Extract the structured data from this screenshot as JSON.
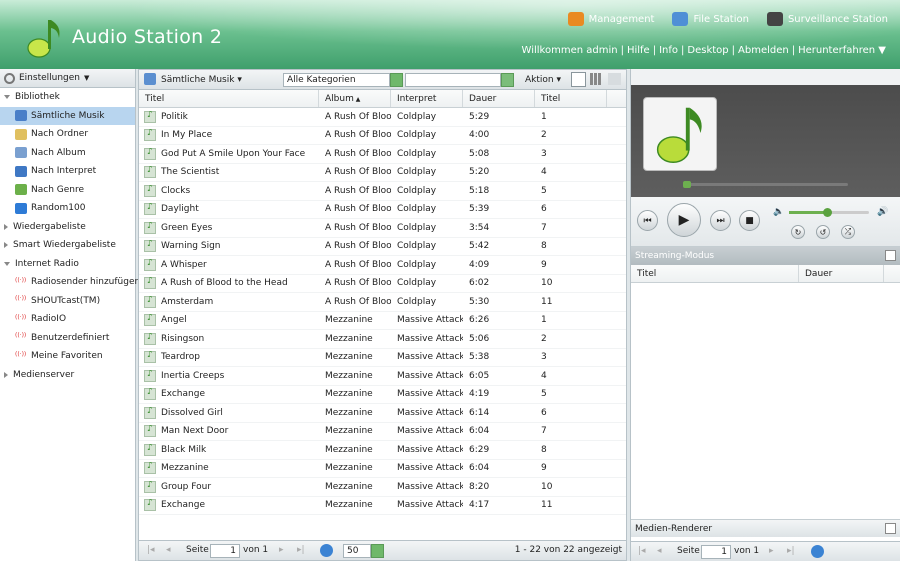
{
  "app": {
    "title": "Audio Station 2"
  },
  "top_links": [
    {
      "label": "Management",
      "icon": "management-icon",
      "color": "#e98a22"
    },
    {
      "label": "File Station",
      "icon": "file-station-icon",
      "color": "#4f8fd6"
    },
    {
      "label": "Surveillance Station",
      "icon": "camera-icon",
      "color": "#444444"
    }
  ],
  "user_bar": {
    "welcome": "Willkommen admin",
    "help": "Hilfe",
    "info": "Info",
    "desktop": "Desktop",
    "logout": "Abmelden",
    "shutdown": "Herunterfahren"
  },
  "left": {
    "settings_label": "Einstellungen",
    "library": {
      "label": "Bibliothek",
      "items": [
        {
          "label": "Sämtliche Musik",
          "icon": "music-note-icon",
          "color": "#4a7fc8"
        },
        {
          "label": "Nach Ordner",
          "icon": "folder-icon",
          "color": "#e0c060"
        },
        {
          "label": "Nach Album",
          "icon": "cd-icon",
          "color": "#7aa0d0"
        },
        {
          "label": "Nach Interpret",
          "icon": "person-icon",
          "color": "#3f78c4"
        },
        {
          "label": "Nach Genre",
          "icon": "genre-icon",
          "color": "#6cb04a"
        },
        {
          "label": "Random100",
          "icon": "random-icon",
          "color": "#2e7bd6"
        }
      ]
    },
    "playlist": {
      "label": "Wiedergabeliste"
    },
    "smart_playlist": {
      "label": "Smart Wiedergabeliste"
    },
    "radio": {
      "label": "Internet Radio",
      "items": [
        {
          "label": "Radiosender hinzufügen",
          "icon": "radio-add-icon"
        },
        {
          "label": "SHOUTcast(TM)",
          "icon": "radio-icon"
        },
        {
          "label": "RadioIO",
          "icon": "radio-icon"
        },
        {
          "label": "Benutzerdefiniert",
          "icon": "radio-icon"
        },
        {
          "label": "Meine Favoriten",
          "icon": "radio-icon"
        }
      ]
    },
    "media_server": {
      "label": "Medienserver"
    }
  },
  "center": {
    "source_label": "Sämtliche Musik",
    "category": "Alle Kategorien",
    "search": "",
    "action_label": "Aktion",
    "columns": [
      "Titel",
      "Album",
      "Interpret",
      "Dauer",
      "Titel"
    ],
    "rows": [
      [
        "Politik",
        "A Rush Of Blood",
        "Coldplay",
        "5:29",
        "1"
      ],
      [
        "In My Place",
        "A Rush Of Blood",
        "Coldplay",
        "4:00",
        "2"
      ],
      [
        "God Put A Smile Upon Your Face",
        "A Rush Of Blood",
        "Coldplay",
        "5:08",
        "3"
      ],
      [
        "The Scientist",
        "A Rush Of Blood",
        "Coldplay",
        "5:20",
        "4"
      ],
      [
        "Clocks",
        "A Rush Of Blood",
        "Coldplay",
        "5:18",
        "5"
      ],
      [
        "Daylight",
        "A Rush Of Blood",
        "Coldplay",
        "5:39",
        "6"
      ],
      [
        "Green Eyes",
        "A Rush Of Blood",
        "Coldplay",
        "3:54",
        "7"
      ],
      [
        "Warning Sign",
        "A Rush Of Blood",
        "Coldplay",
        "5:42",
        "8"
      ],
      [
        "A Whisper",
        "A Rush Of Blood",
        "Coldplay",
        "4:09",
        "9"
      ],
      [
        "A Rush of Blood to the Head",
        "A Rush Of Blood",
        "Coldplay",
        "6:02",
        "10"
      ],
      [
        "Amsterdam",
        "A Rush Of Blood",
        "Coldplay",
        "5:30",
        "11"
      ],
      [
        "Angel",
        "Mezzanine",
        "Massive Attack",
        "6:26",
        "1"
      ],
      [
        "Risingson",
        "Mezzanine",
        "Massive Attack",
        "5:06",
        "2"
      ],
      [
        "Teardrop",
        "Mezzanine",
        "Massive Attack",
        "5:38",
        "3"
      ],
      [
        "Inertia Creeps",
        "Mezzanine",
        "Massive Attack",
        "6:05",
        "4"
      ],
      [
        "Exchange",
        "Mezzanine",
        "Massive Attack",
        "4:19",
        "5"
      ],
      [
        "Dissolved Girl",
        "Mezzanine",
        "Massive Attack",
        "6:14",
        "6"
      ],
      [
        "Man Next Door",
        "Mezzanine",
        "Massive Attack",
        "6:04",
        "7"
      ],
      [
        "Black Milk",
        "Mezzanine",
        "Massive Attack",
        "6:29",
        "8"
      ],
      [
        "Mezzanine",
        "Mezzanine",
        "Massive Attack",
        "6:04",
        "9"
      ],
      [
        "Group Four",
        "Mezzanine",
        "Massive Attack",
        "8:20",
        "10"
      ],
      [
        "Exchange",
        "Mezzanine",
        "Massive Attack",
        "4:17",
        "11"
      ]
    ],
    "pager": {
      "page_label": "Seite",
      "page": "1",
      "of_label": "von 1",
      "per_page": "50",
      "summary": "1 - 22 von 22 angezeigt"
    }
  },
  "right": {
    "streaming_label": "Streaming-Modus",
    "columns": [
      "Titel",
      "Dauer"
    ],
    "renderer_label": "Medien-Renderer",
    "pager": {
      "page_label": "Seite",
      "page": "1",
      "of_label": "von 1"
    },
    "volume_level": 0.48
  }
}
